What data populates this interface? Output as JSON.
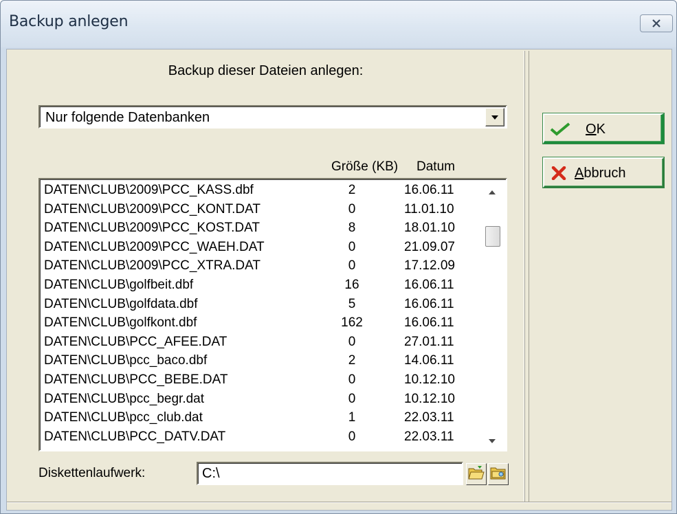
{
  "window": {
    "title": "Backup anlegen"
  },
  "caption": "Backup dieser Dateien anlegen:",
  "selection": {
    "value": "Nur folgende Datenbanken"
  },
  "columns": {
    "size": "Größe (KB)",
    "date": "Datum"
  },
  "files": [
    {
      "name": "DATEN\\CLUB\\2009\\PCC_KASS.dbf",
      "size": "2",
      "date": "16.06.11"
    },
    {
      "name": "DATEN\\CLUB\\2009\\PCC_KONT.DAT",
      "size": "0",
      "date": "11.01.10"
    },
    {
      "name": "DATEN\\CLUB\\2009\\PCC_KOST.DAT",
      "size": "8",
      "date": "18.01.10"
    },
    {
      "name": "DATEN\\CLUB\\2009\\PCC_WAEH.DAT",
      "size": "0",
      "date": "21.09.07"
    },
    {
      "name": "DATEN\\CLUB\\2009\\PCC_XTRA.DAT",
      "size": "0",
      "date": "17.12.09"
    },
    {
      "name": "DATEN\\CLUB\\golfbeit.dbf",
      "size": "16",
      "date": "16.06.11"
    },
    {
      "name": "DATEN\\CLUB\\golfdata.dbf",
      "size": "5",
      "date": "16.06.11"
    },
    {
      "name": "DATEN\\CLUB\\golfkont.dbf",
      "size": "162",
      "date": "16.06.11"
    },
    {
      "name": "DATEN\\CLUB\\PCC_AFEE.DAT",
      "size": "0",
      "date": "27.01.11"
    },
    {
      "name": "DATEN\\CLUB\\pcc_baco.dbf",
      "size": "2",
      "date": "14.06.11"
    },
    {
      "name": "DATEN\\CLUB\\PCC_BEBE.DAT",
      "size": "0",
      "date": "10.12.10"
    },
    {
      "name": "DATEN\\CLUB\\pcc_begr.dat",
      "size": "0",
      "date": "10.12.10"
    },
    {
      "name": "DATEN\\CLUB\\pcc_club.dat",
      "size": "1",
      "date": "22.03.11"
    },
    {
      "name": "DATEN\\CLUB\\PCC_DATV.DAT",
      "size": "0",
      "date": "22.03.11"
    }
  ],
  "drive": {
    "label": "Diskettenlaufwerk:",
    "value": "C:\\"
  },
  "buttons": {
    "ok_accel": "O",
    "ok_rest": "K",
    "cancel_accel": "A",
    "cancel_rest": "bbruch"
  },
  "icons": {
    "close": "close-icon",
    "dropdown": "chevron-down-icon",
    "scroll_up": "arrow-up-icon",
    "scroll_down": "arrow-down-icon",
    "folder_open": "folder-open-icon",
    "folder_browse": "folder-icon",
    "ok": "checkmark-icon",
    "cancel": "x-icon"
  },
  "colors": {
    "ok_check": "#2e9b2e",
    "cancel_x": "#d42b1a",
    "button_border": "#2a7a3a"
  }
}
